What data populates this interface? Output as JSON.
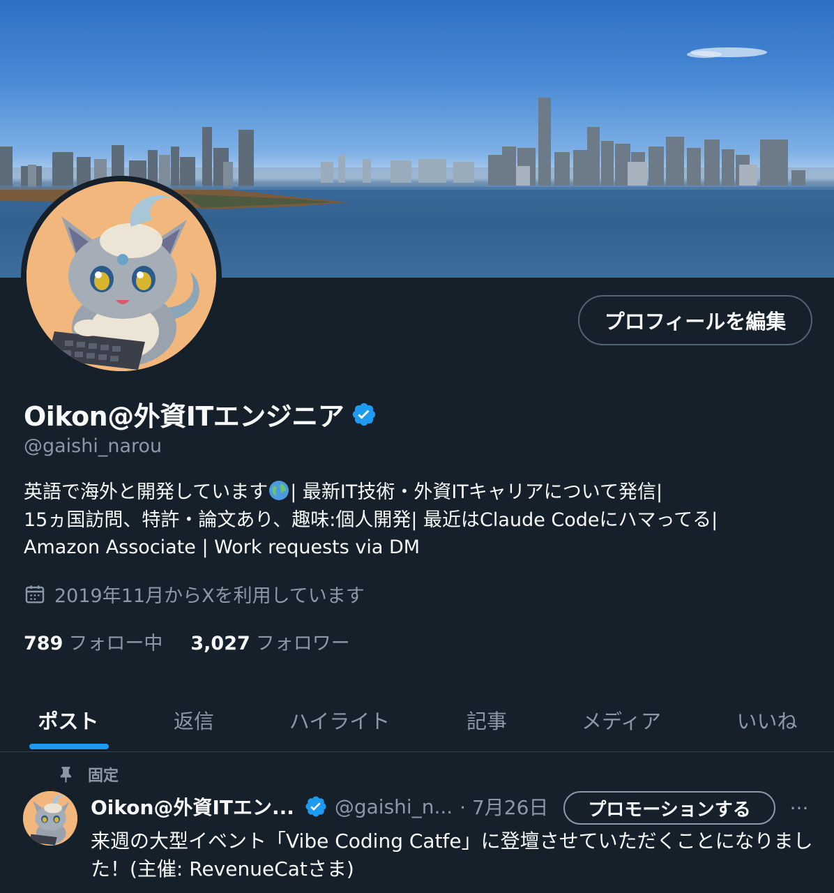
{
  "profile": {
    "display_name": "Oikon@外資ITエンジニア",
    "handle": "@gaishi_narou",
    "verified": true,
    "edit_button": "プロフィールを編集",
    "bio_lines": [
      "英語で海外と開発しています",
      "| 最新IT技術・外資ITキャリアについて発信|",
      "15ヵ国訪問、特許・論文あり、趣味:個人開発| 最近はClaude Codeにハマってる|",
      "Amazon Associate | Work requests via DM"
    ],
    "joined": "2019年11月からXを利用しています",
    "following_count": "789",
    "following_label": "フォロー中",
    "followers_count": "3,027",
    "followers_label": "フォロワー"
  },
  "tabs": [
    "ポスト",
    "返信",
    "ハイライト",
    "記事",
    "メディア",
    "いいね"
  ],
  "active_tab": "ポスト",
  "pinned_post": {
    "pinned_label": "固定",
    "author_name": "Oikon@外資ITエン...",
    "author_handle": "@gaishi_n...",
    "date": "· 7月26日",
    "promote_button": "プロモーションする",
    "more": "···",
    "text": "来週の大型イベント「Vibe Coding Catfe」に登壇させていただくことになりました！(主催: RevenueCatさま)"
  },
  "colors": {
    "background": "#15202b",
    "accent": "#1d9bf0",
    "muted_text": "#8b98a5",
    "border": "#536471"
  },
  "icons": {
    "verified": "verified-badge-icon",
    "calendar": "calendar-icon",
    "pin": "pin-icon",
    "globe": "globe-icon"
  }
}
